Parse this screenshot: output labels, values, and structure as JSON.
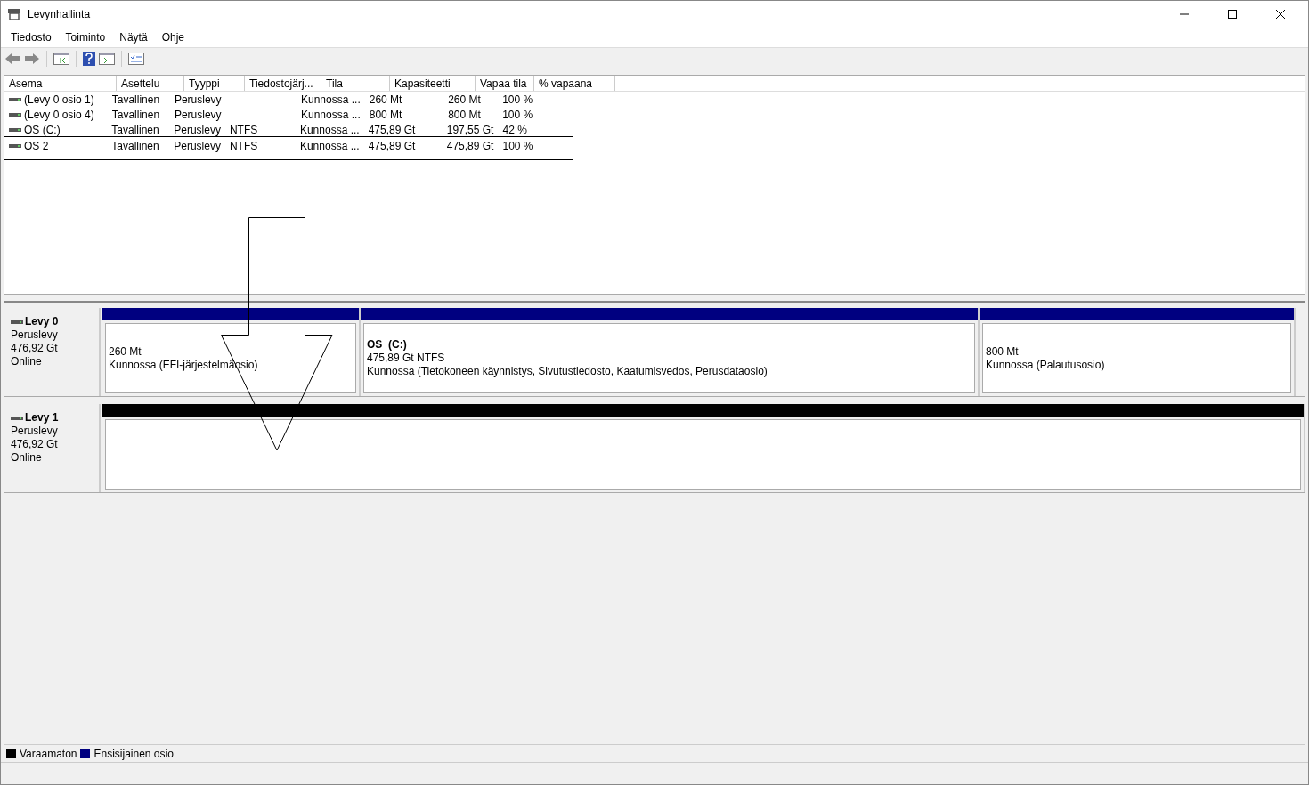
{
  "window": {
    "title": "Levynhallinta"
  },
  "menu": [
    "Tiedosto",
    "Toiminto",
    "Näytä",
    "Ohje"
  ],
  "table": {
    "columns": [
      "Asema",
      "Asettelu",
      "Tyyppi",
      "Tiedostojärj...",
      "Tila",
      "Kapasiteetti",
      "Vapaa tila",
      "% vapaana"
    ],
    "rows": [
      {
        "selected": false,
        "cells": [
          "(Levy 0 osio 1)",
          "Tavallinen",
          "Peruslevy",
          "",
          "Kunnossa ...",
          "260 Mt",
          "260 Mt",
          "100 %"
        ]
      },
      {
        "selected": false,
        "cells": [
          "(Levy 0 osio 4)",
          "Tavallinen",
          "Peruslevy",
          "",
          "Kunnossa ...",
          "800 Mt",
          "800 Mt",
          "100 %"
        ]
      },
      {
        "selected": false,
        "cells": [
          "OS (C:)",
          "Tavallinen",
          "Peruslevy",
          "NTFS",
          "Kunnossa ...",
          "475,89 Gt",
          "197,55 Gt",
          "42 %"
        ]
      },
      {
        "selected": true,
        "cells": [
          "OS 2",
          "Tavallinen",
          "Peruslevy",
          "NTFS",
          "Kunnossa ...",
          "475,89 Gt",
          "475,89 Gt",
          "100 %"
        ]
      }
    ]
  },
  "disks": [
    {
      "name": "Levy 0",
      "type": "Peruslevy",
      "size": "476,92 Gt",
      "status": "Online",
      "partitions": [
        {
          "color": "#000080",
          "lines": [
            "260 Mt",
            "Kunnossa (EFI-järjestelmäosio)"
          ]
        },
        {
          "color": "#000080",
          "title": "OS  (C:)",
          "lines": [
            "475,89 Gt NTFS",
            "Kunnossa (Tietokoneen käynnistys, Sivutustiedosto, Kaatumisvedos, Perusdataosio)"
          ]
        },
        {
          "color": "#000080",
          "lines": [
            "800 Mt",
            "Kunnossa (Palautusosio)"
          ]
        }
      ]
    },
    {
      "name": "Levy 1",
      "type": "Peruslevy",
      "size": "476,92 Gt",
      "status": "Online",
      "partitions": [
        {
          "color": "#000000"
        }
      ]
    }
  ],
  "legend": [
    {
      "label": "Varaamaton",
      "color": "#000000"
    },
    {
      "label": "Ensisijainen osio",
      "color": "#000080"
    }
  ]
}
